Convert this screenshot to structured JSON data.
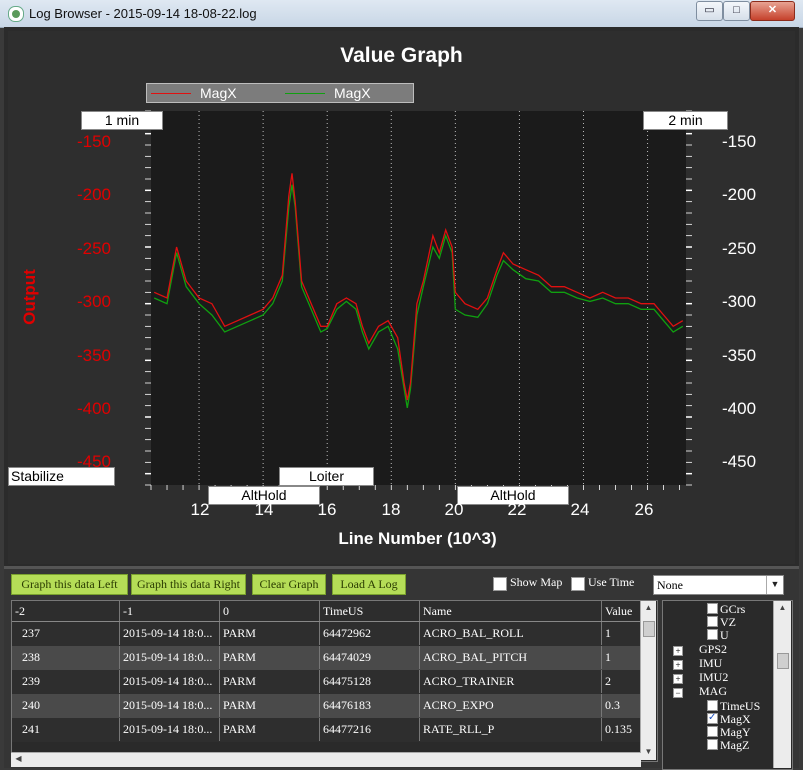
{
  "window": {
    "title": "Log Browser - 2015-09-14 18-08-22.log",
    "controls": {
      "minimize": "▭",
      "maximize": "□",
      "close": "✕"
    }
  },
  "graph": {
    "title": "Value Graph",
    "legend": [
      {
        "label": "MagX",
        "color": "#e01010"
      },
      {
        "label": "MagX",
        "color": "#10a010"
      }
    ],
    "time_markers": {
      "left": "1 min",
      "right": "2 min"
    },
    "mode_labels": [
      {
        "label": "Stabilize"
      },
      {
        "label": "AltHold"
      },
      {
        "label": "Loiter"
      },
      {
        "label": "AltHold"
      }
    ],
    "ylabel": "Output",
    "xlabel": "Line Number (10^3)"
  },
  "chart_data": {
    "type": "line",
    "title": "Value Graph",
    "xlabel": "Line Number (10^3)",
    "ylabel": "Output",
    "xlim": [
      10.5,
      27.2
    ],
    "ylim": [
      -460,
      -130
    ],
    "xticks": [
      "12",
      "14",
      "16",
      "18",
      "20",
      "22",
      "24",
      "26"
    ],
    "yticks": [
      "-150",
      "-200",
      "-250",
      "-300",
      "-350",
      "-400",
      "-450"
    ],
    "grid": true,
    "legend_position": "top-left",
    "series": [
      {
        "name": "MagX",
        "color": "#e01010",
        "x": [
          10.6,
          11.0,
          11.3,
          11.6,
          12.0,
          12.4,
          12.8,
          13.2,
          13.6,
          14.0,
          14.3,
          14.6,
          14.8,
          14.9,
          15.0,
          15.2,
          15.5,
          15.8,
          16.0,
          16.3,
          16.6,
          16.9,
          17.1,
          17.3,
          17.6,
          17.9,
          18.2,
          18.4,
          18.5,
          18.6,
          18.8,
          19.0,
          19.3,
          19.5,
          19.7,
          19.9,
          20.0,
          20.3,
          20.7,
          21.0,
          21.3,
          21.5,
          21.8,
          22.2,
          22.6,
          23.0,
          23.4,
          23.8,
          24.2,
          24.6,
          25.0,
          25.4,
          25.8,
          26.2,
          26.5,
          26.8,
          27.1
        ],
        "y": [
          -290,
          -295,
          -250,
          -280,
          -295,
          -300,
          -320,
          -315,
          -310,
          -305,
          -295,
          -275,
          -205,
          -185,
          -210,
          -280,
          -300,
          -320,
          -320,
          -300,
          -295,
          -300,
          -320,
          -335,
          -320,
          -315,
          -330,
          -370,
          -385,
          -370,
          -300,
          -280,
          -240,
          -255,
          -235,
          -250,
          -290,
          -300,
          -305,
          -295,
          -270,
          -255,
          -265,
          -270,
          -275,
          -285,
          -285,
          -290,
          -295,
          -290,
          -295,
          -295,
          -300,
          -300,
          -310,
          -320,
          -315
        ]
      },
      {
        "name": "MagX",
        "color": "#10a010",
        "x": [
          10.6,
          11.0,
          11.3,
          11.6,
          12.0,
          12.4,
          12.8,
          13.2,
          13.6,
          14.0,
          14.3,
          14.6,
          14.8,
          14.9,
          15.0,
          15.2,
          15.5,
          15.8,
          16.0,
          16.3,
          16.6,
          16.9,
          17.1,
          17.3,
          17.6,
          17.9,
          18.2,
          18.4,
          18.5,
          18.6,
          18.8,
          19.0,
          19.3,
          19.5,
          19.7,
          19.9,
          20.0,
          20.3,
          20.7,
          21.0,
          21.3,
          21.5,
          21.8,
          22.2,
          22.6,
          23.0,
          23.4,
          23.8,
          24.2,
          24.6,
          25.0,
          25.4,
          25.8,
          26.2,
          26.5,
          26.8,
          27.1
        ],
        "y": [
          -295,
          -300,
          -255,
          -285,
          -300,
          -310,
          -325,
          -320,
          -315,
          -310,
          -300,
          -280,
          -215,
          -195,
          -215,
          -285,
          -305,
          -325,
          -322,
          -305,
          -298,
          -305,
          -325,
          -340,
          -325,
          -320,
          -340,
          -375,
          -392,
          -375,
          -310,
          -285,
          -250,
          -260,
          -240,
          -255,
          -305,
          -310,
          -312,
          -300,
          -275,
          -262,
          -270,
          -278,
          -280,
          -290,
          -290,
          -295,
          -298,
          -295,
          -300,
          -300,
          -305,
          -305,
          -315,
          -325,
          -320
        ]
      }
    ]
  },
  "toolbar": {
    "graph_left": "Graph this data Left",
    "graph_right": "Graph this data Right",
    "clear_graph": "Clear Graph",
    "load_log": "Load A Log",
    "show_map": "Show Map",
    "use_time": "Use Time",
    "dropdown_value": "None"
  },
  "table": {
    "headers": [
      "-2",
      "-1",
      "0",
      "TimeUS",
      "Name",
      "Value"
    ],
    "rows": [
      [
        "237",
        "2015-09-14 18:0...",
        "PARM",
        "64472962",
        "ACRO_BAL_ROLL",
        "1"
      ],
      [
        "238",
        "2015-09-14 18:0...",
        "PARM",
        "64474029",
        "ACRO_BAL_PITCH",
        "1"
      ],
      [
        "239",
        "2015-09-14 18:0...",
        "PARM",
        "64475128",
        "ACRO_TRAINER",
        "2"
      ],
      [
        "240",
        "2015-09-14 18:0...",
        "PARM",
        "64476183",
        "ACRO_EXPO",
        "0.3"
      ],
      [
        "241",
        "2015-09-14 18:0...",
        "PARM",
        "64477216",
        "RATE_RLL_P",
        "0.135"
      ]
    ]
  },
  "tree": {
    "items": [
      {
        "label": "GCrs",
        "kind": "check",
        "checked": false
      },
      {
        "label": "VZ",
        "kind": "check",
        "checked": false
      },
      {
        "label": "U",
        "kind": "check",
        "checked": false
      },
      {
        "label": "GPS2",
        "kind": "node",
        "expanded": false
      },
      {
        "label": "IMU",
        "kind": "node",
        "expanded": false
      },
      {
        "label": "IMU2",
        "kind": "node",
        "expanded": false
      },
      {
        "label": "MAG",
        "kind": "node",
        "expanded": true
      },
      {
        "label": "TimeUS",
        "kind": "check",
        "checked": false
      },
      {
        "label": "MagX",
        "kind": "check",
        "checked": true
      },
      {
        "label": "MagY",
        "kind": "check",
        "checked": false
      },
      {
        "label": "MagZ",
        "kind": "check",
        "checked": false
      }
    ]
  }
}
